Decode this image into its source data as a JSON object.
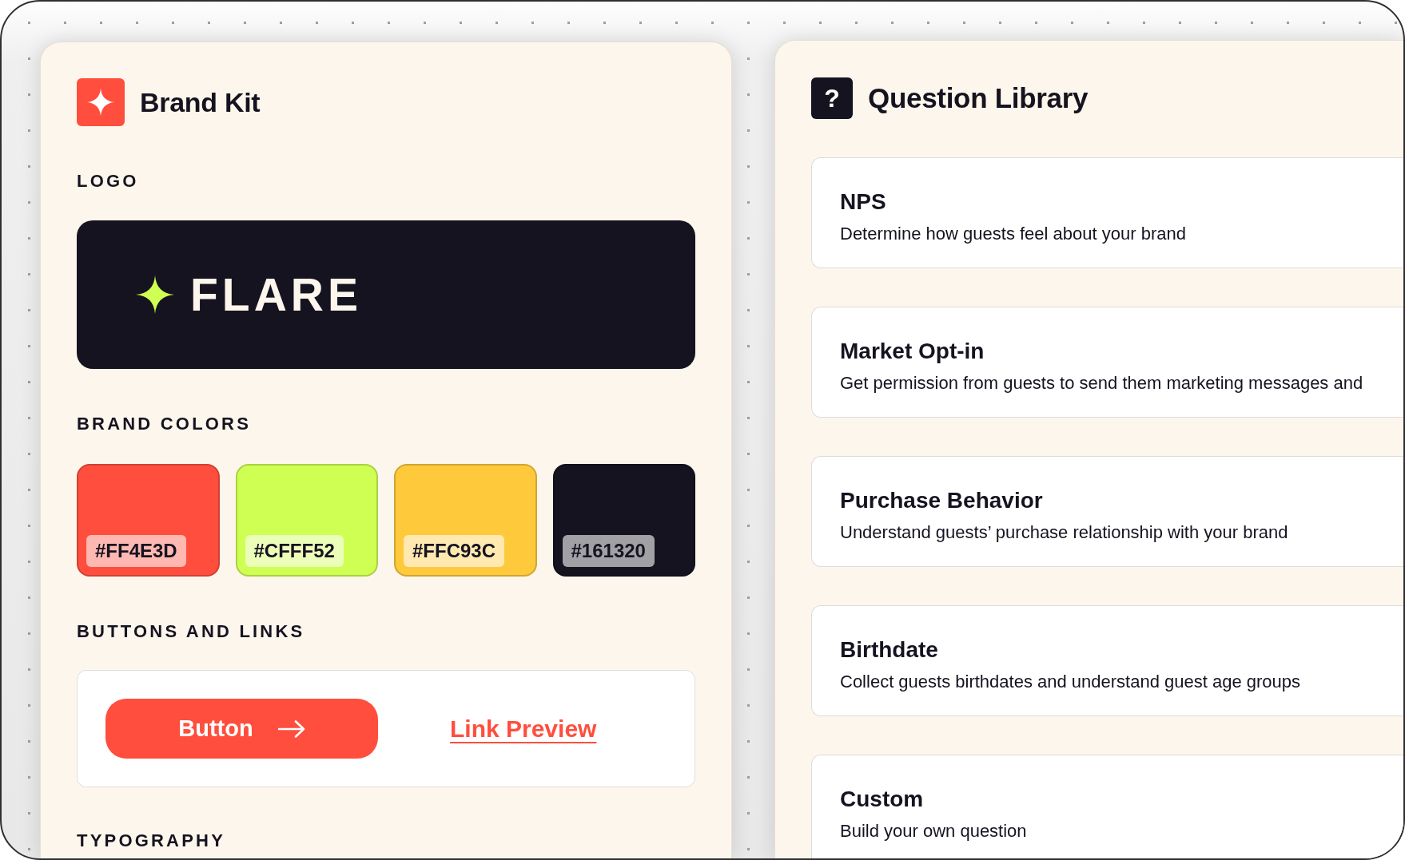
{
  "brand_kit": {
    "title": "Brand Kit",
    "logo": {
      "heading": "LOGO",
      "wordmark": "FLARE"
    },
    "brand_colors": {
      "heading": "BRAND COLORS",
      "swatches": [
        {
          "label": "#FF4E3D",
          "color": "#ff4e3d"
        },
        {
          "label": "#CFFF52",
          "color": "#cfff52"
        },
        {
          "label": "#FFC93C",
          "color": "#ffc93c"
        },
        {
          "label": "#161320",
          "color": "#161320"
        }
      ]
    },
    "buttons_and_links": {
      "heading": "BUTTONS AND LINKS",
      "button": {
        "label": "Button"
      },
      "link": {
        "label": "Link Preview"
      }
    },
    "typography": {
      "heading": "TYPOGRAPHY"
    }
  },
  "question_library": {
    "icon": "?",
    "title": "Question Library",
    "questions": [
      {
        "title": "NPS",
        "description": "Determine how guests feel about your brand"
      },
      {
        "title": "Market Opt-in",
        "description": "Get permission from guests to send them marketing messages and"
      },
      {
        "title": "Purchase Behavior",
        "description": "Understand guests’ purchase relationship with your brand"
      },
      {
        "title": "Birthdate",
        "description": "Collect guests birthdates and understand guest age groups"
      },
      {
        "title": "Custom",
        "description": "Build your own question"
      }
    ]
  }
}
